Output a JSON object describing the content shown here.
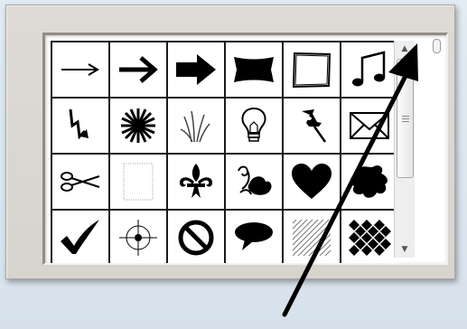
{
  "picker": {
    "shapes": [
      {
        "icon": "thin-arrow-right-icon"
      },
      {
        "icon": "arrow-right-icon"
      },
      {
        "icon": "block-arrow-right-icon"
      },
      {
        "icon": "banner-rectangle-icon"
      },
      {
        "icon": "rough-square-frame-icon"
      },
      {
        "icon": "music-notes-icon"
      },
      {
        "icon": "lightning-bolt-icon"
      },
      {
        "icon": "starburst-icon"
      },
      {
        "icon": "grass-icon"
      },
      {
        "icon": "light-bulb-icon"
      },
      {
        "icon": "push-pin-icon"
      },
      {
        "icon": "envelope-icon"
      },
      {
        "icon": "scissors-icon"
      },
      {
        "icon": "dotted-rectangle-icon"
      },
      {
        "icon": "fleur-de-lis-icon"
      },
      {
        "icon": "floral-ornament-icon"
      },
      {
        "icon": "heart-icon"
      },
      {
        "icon": "ink-splat-icon"
      },
      {
        "icon": "checkmark-icon"
      },
      {
        "icon": "crosshair-target-icon"
      },
      {
        "icon": "no-symbol-icon"
      },
      {
        "icon": "speech-bubble-icon"
      },
      {
        "icon": "diagonal-hatch-pattern-icon"
      },
      {
        "icon": "checkerboard-diamond-pattern-icon"
      }
    ]
  },
  "scrollbar": {
    "up_icon": "scroll-up-arrow-icon",
    "down_icon": "scroll-down-arrow-icon"
  },
  "annotation": {
    "color": "#000000"
  },
  "colors": {
    "frame": "#d9d6d0",
    "grid_line": "#1a1a1a",
    "background": "#dce6ef"
  }
}
